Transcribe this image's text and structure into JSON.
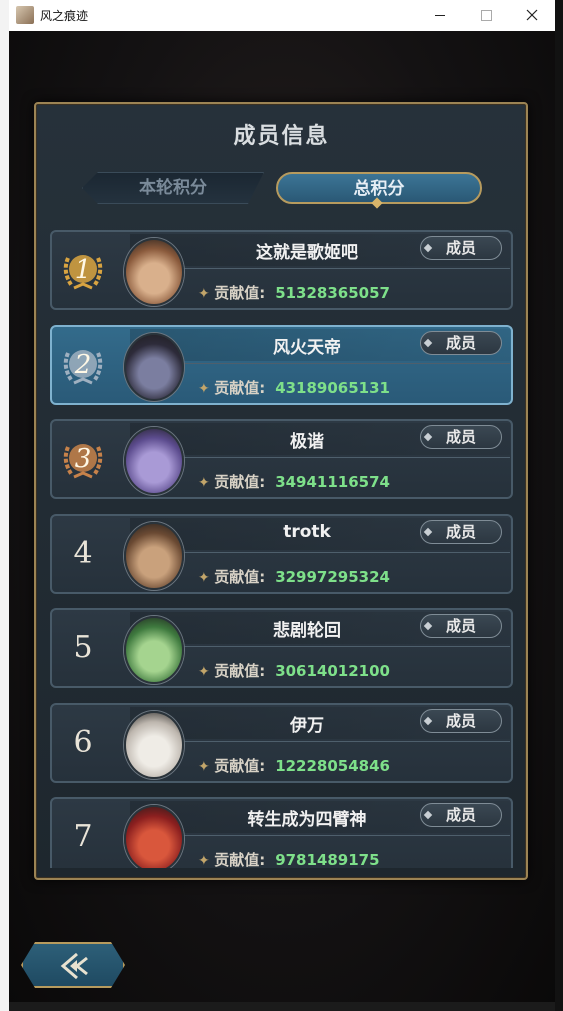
{
  "window": {
    "title": "风之痕迹",
    "controls": {
      "minimize": "minimize-icon",
      "maximize": "maximize-icon",
      "close": "close-icon"
    }
  },
  "panel": {
    "title": "成员信息",
    "tabs": [
      {
        "label": "本轮积分",
        "active": false
      },
      {
        "label": "总积分",
        "active": true
      }
    ]
  },
  "contribution_label": "贡献值:",
  "members": [
    {
      "rank": "1",
      "name": "这就是歌姬吧",
      "role": "成员",
      "contribution": "51328365057",
      "medal": "gold"
    },
    {
      "rank": "2",
      "name": "风火天帝",
      "role": "成员",
      "contribution": "43189065131",
      "medal": "silver",
      "is_self": true
    },
    {
      "rank": "3",
      "name": "极谐",
      "role": "成员",
      "contribution": "34941116574",
      "medal": "bronze"
    },
    {
      "rank": "4",
      "name": "trotk",
      "role": "成员",
      "contribution": "32997295324"
    },
    {
      "rank": "5",
      "name": "悲剧轮回",
      "role": "成员",
      "contribution": "30614012100"
    },
    {
      "rank": "6",
      "name": "伊万",
      "role": "成员",
      "contribution": "12228054846"
    },
    {
      "rank": "7",
      "name": "转生成为四臂神",
      "role": "成员",
      "contribution": "9781489175"
    }
  ],
  "back_button": {
    "icon": "back-arrow-icon"
  },
  "colors": {
    "gold": "#d9a441",
    "silver": "#9fb0c0",
    "bronze": "#c7824a",
    "contribution_value": "#7ee08a",
    "frame": "#9c8454"
  }
}
